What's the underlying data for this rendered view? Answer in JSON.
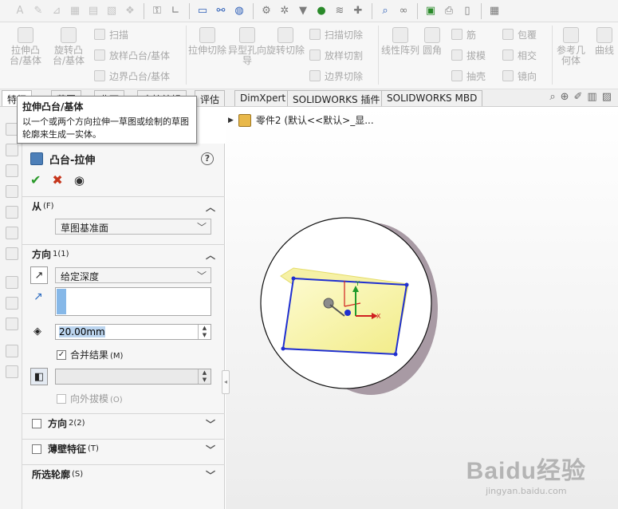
{
  "toolbar": {
    "icons": [
      "text-icon",
      "edit-icon",
      "sketch-icon",
      "grid-icon",
      "layer-icon",
      "hatch-icon",
      "pattern-icon",
      "key-icon",
      "angle-icon",
      "monitor-icon",
      "network-icon",
      "globe-icon",
      "gear-icon",
      "settings-icon",
      "hopper-icon",
      "pin-icon",
      "zigzag-icon",
      "cross-icon",
      "search-icon",
      "binoculars-icon",
      "excel-icon",
      "print-icon",
      "document-icon",
      "calendar-icon"
    ]
  },
  "ribbon": {
    "extrude_boss": "拉伸凸台/基体",
    "revolve_boss": "旋转凸台/基体",
    "sweep": "扫描",
    "loft_boss": "放样凸台/基体",
    "boundary_boss": "边界凸台/基体",
    "extrude_cut": "拉伸切除",
    "hole_wizard": "异型孔向导",
    "revolve_cut": "旋转切除",
    "sweep_cut": "扫描切除",
    "loft_cut": "放样切割",
    "boundary_cut": "边界切除",
    "linear_pattern": "线性阵列",
    "fillet": "圆角",
    "rib": "筋",
    "draft": "拔模",
    "shell": "抽壳",
    "wrap": "包覆",
    "intersect": "相交",
    "mirror": "镜向",
    "ref_geometry": "参考几何体",
    "curves": "曲线"
  },
  "tabs": [
    "特征",
    "草图",
    "曲面",
    "直接编辑",
    "评估",
    "DimXpert",
    "SOLIDWORKS 插件",
    "SOLIDWORKS MBD"
  ],
  "tooltip": {
    "title": "拉伸凸台/基体",
    "body": "以一个或两个方向拉伸一草图或绘制的草图轮廓来生成一实体。"
  },
  "tree": {
    "part_label": "零件2 (默认<<默认>_显..."
  },
  "property_manager": {
    "title": "凸台-拉伸",
    "help": "?",
    "from": {
      "label": "从",
      "mnemonic": "(F)",
      "value": "草图基准面"
    },
    "direction1": {
      "label": "方向",
      "mnemonic": "1(1)",
      "end_condition": "给定深度",
      "depth": "20.00mm",
      "merge_label": "合并结果",
      "merge_mnemonic": "(M)",
      "merge_checked": true,
      "draft_outward_label": "向外拔模",
      "draft_outward_mnemonic": "(O)",
      "draft_outward_checked": false
    },
    "direction2": {
      "label": "方向",
      "mnemonic": "2(2)",
      "checked": false
    },
    "thin_feature": {
      "label": "薄壁特征",
      "mnemonic": "(T)",
      "checked": false
    },
    "selected_contours": {
      "label": "所选轮廓",
      "mnemonic": "(S)"
    }
  },
  "viewport": {
    "triad_y": "Y",
    "triad_x": "X"
  },
  "watermark": {
    "logo": "Baidu经验",
    "url": "jingyan.baidu.com"
  },
  "colors": {
    "accent_blue": "#1f2fd0",
    "preview_yellow": "#fbf6a0",
    "disc_shadow": "#a89aa4",
    "ok_green": "#2a9a2a",
    "cancel_red": "#c6361c"
  }
}
